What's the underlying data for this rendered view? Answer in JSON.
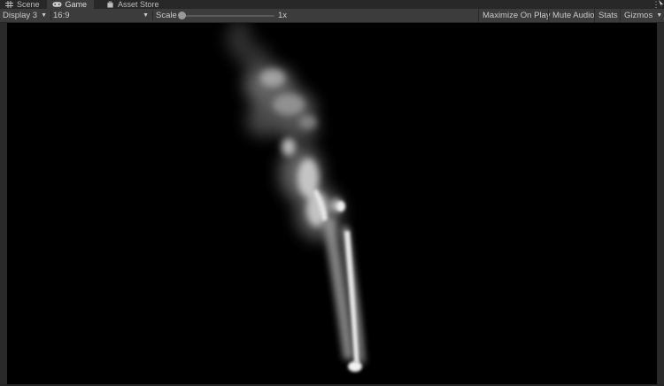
{
  "tabs": [
    {
      "label": "Scene",
      "icon": "grid-icon",
      "active": false
    },
    {
      "label": "Game",
      "icon": "gamepad-icon",
      "active": true
    },
    {
      "label": "Asset Store",
      "icon": "bag-icon",
      "active": false
    }
  ],
  "toolbar": {
    "display": "Display 3",
    "aspect": "16:9",
    "scale_label": "Scale",
    "scale_value": "1x",
    "scale_slider_value": 0,
    "maximize_on_play": "Maximize On Play",
    "mute_audio": "Mute Audio",
    "stats": "Stats",
    "gizmos": "Gizmos"
  },
  "colors": {
    "background": "#000000",
    "toolbar": "#3c3c3c",
    "tabbar": "#282828",
    "smoke": "#e6e6e6"
  }
}
